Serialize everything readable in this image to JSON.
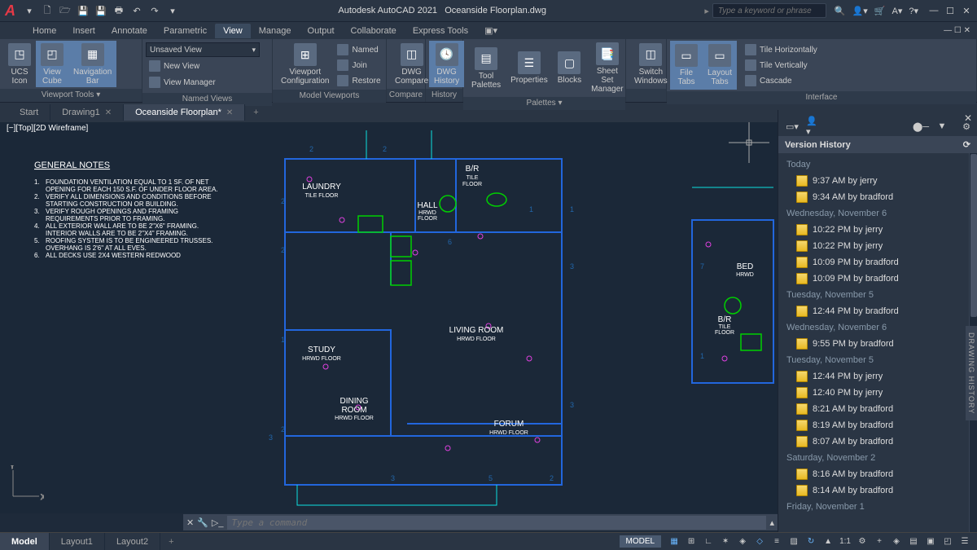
{
  "app": {
    "title": "Autodesk AutoCAD 2021",
    "filename": "Oceanside Floorplan.dwg",
    "search_placeholder": "Type a keyword or phrase"
  },
  "menu": [
    "Home",
    "Insert",
    "Annotate",
    "Parametric",
    "View",
    "Manage",
    "Output",
    "Collaborate",
    "Express Tools"
  ],
  "menu_active": 4,
  "ribbon": {
    "viewport_tools": {
      "title": "Viewport Tools ▾",
      "ucs": "UCS\nIcon",
      "viewcube": "View\nCube",
      "navbar": "Navigation\nBar"
    },
    "named_views": {
      "title": "Named Views",
      "combo": "Unsaved View",
      "new_view": "New View",
      "view_manager": "View Manager"
    },
    "model_viewports": {
      "title": "Model Viewports",
      "config": "Viewport\nConfiguration",
      "named": "Named",
      "join": "Join",
      "restore": "Restore"
    },
    "compare": {
      "title": "Compare",
      "c1": "DWG\nCompare"
    },
    "history": {
      "title": "History",
      "c1": "DWG\nHistory"
    },
    "palettes": {
      "title": "Palettes ▾",
      "p1": "Tool\nPalettes",
      "p2": "Properties",
      "p3": "Blocks",
      "p4": "Sheet Set\nManager"
    },
    "windows": {
      "title": " ",
      "w1": "Switch\nWindows",
      "w2": "File\nTabs",
      "w3": "Layout\nTabs"
    },
    "interface": {
      "title": "Interface",
      "i1": "Tile Horizontally",
      "i2": "Tile Vertically",
      "i3": "Cascade"
    }
  },
  "doctabs": [
    {
      "label": "Start",
      "active": false,
      "closable": false
    },
    {
      "label": "Drawing1",
      "active": false,
      "closable": true
    },
    {
      "label": "Oceanside Floorplan*",
      "active": true,
      "closable": true
    }
  ],
  "vplabel": "[−][Top][2D Wireframe]",
  "notes": {
    "title": "GENERAL NOTES",
    "items": [
      "FOUNDATION VENTILATION EQUAL TO 1 SF. OF NET OPENING FOR EACH 150 S.F. OF UNDER FLOOR AREA.",
      "VERIFY ALL DIMENSIONS AND CONDITIONS BEFORE STARTING CONSTRUCTION OR BUILDING.",
      "VERIFY ROUGH OPENINGS AND FRAMING REQUIREMENTS PRIOR TO FRAMING.",
      "ALL EXTERIOR WALL ARE TO BE 2\"X6\" FRAMING. INTERIOR WALLS ARE TO BE 2\"X4\" FRAMING.",
      "ROOFING SYSTEM IS TO BE ENGINEERED TRUSSES. OVERHANG IS 2'6\" AT ALL EVES.",
      "ALL DECKS USE 2X4 WESTERN REDWOOD"
    ]
  },
  "rooms": {
    "laundry": {
      "name": "LAUNDRY",
      "sub": "TILE  FLOOR"
    },
    "br": {
      "name": "B/R",
      "sub": "TILE\nFLOOR"
    },
    "hall": {
      "name": "HALL",
      "sub": "HRWD\nFLOOR"
    },
    "living": {
      "name": "LIVING  ROOM",
      "sub": "HRWD  FLOOR"
    },
    "study": {
      "name": "STUDY",
      "sub": "HRWD  FLOOR"
    },
    "dining": {
      "name": "DINING ROOM",
      "sub": "HRWD  FLOOR"
    },
    "forum": {
      "name": "FORUM",
      "sub": "HRWD  FLOOR"
    },
    "bed": {
      "name": "BED",
      "sub": "HRWD"
    },
    "br2": {
      "name": "B/R",
      "sub": "TILE\nFLOOR"
    }
  },
  "cmd_placeholder": "Type a command",
  "layout_tabs": [
    "Model",
    "Layout1",
    "Layout2"
  ],
  "model_badge": "MODEL",
  "scale": "1:1",
  "history_tab": "DRAWING HISTORY",
  "vhist": {
    "title": "Version History",
    "groups": [
      {
        "label": "Today",
        "items": [
          "9:37 AM by jerry",
          "9:34 AM by bradford"
        ]
      },
      {
        "label": "Wednesday, November 6",
        "items": [
          "10:22 PM by jerry",
          "10:22 PM by jerry",
          "10:09 PM by bradford",
          "10:09 PM by bradford"
        ]
      },
      {
        "label": "Tuesday, November 5",
        "items": [
          "12:44 PM by bradford"
        ]
      },
      {
        "label": "Wednesday, November 6",
        "items": [
          "9:55 PM by bradford"
        ]
      },
      {
        "label": "Tuesday, November 5",
        "items": [
          "12:44 PM by jerry",
          "12:40 PM by jerry",
          "8:21 AM by bradford",
          "8:19 AM by bradford",
          "8:07 AM by bradford"
        ]
      },
      {
        "label": "Saturday, November 2",
        "items": [
          "8:16 AM by bradford",
          "8:14 AM by bradford"
        ]
      },
      {
        "label": "Friday, November 1",
        "items": []
      }
    ]
  }
}
